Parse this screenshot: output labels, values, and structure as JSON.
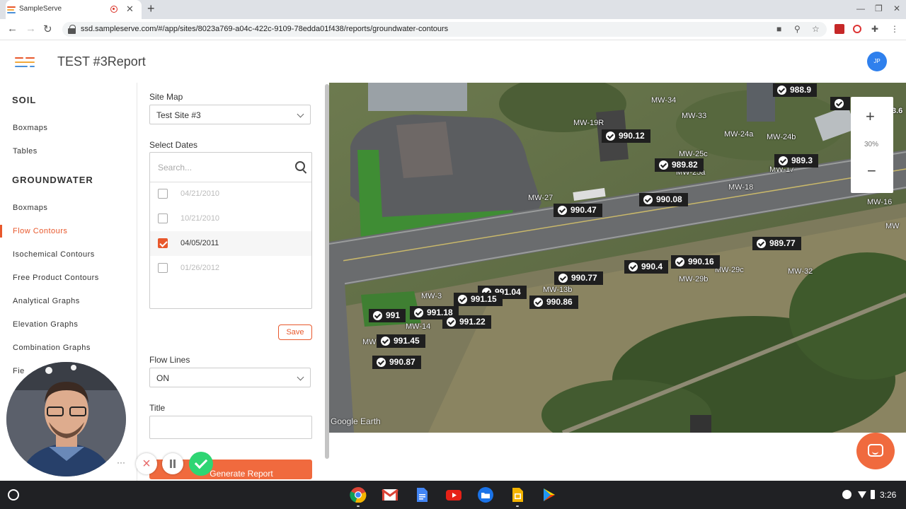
{
  "browser": {
    "tab_title": "SampleServe",
    "url": "ssd.sampleserve.com/#/app/sites/8023a769-a04c-422c-9109-78edda01f438/reports/groundwater-contours"
  },
  "app": {
    "title": "TEST #3Report",
    "user_initials": "JP"
  },
  "sidebar": {
    "soil_heading": "SOIL",
    "soil_items": [
      "Boxmaps",
      "Tables"
    ],
    "groundwater_heading": "GROUNDWATER",
    "groundwater_items": [
      "Boxmaps",
      "Flow Contours",
      "Isochemical Contours",
      "Free Product Contours",
      "Analytical Graphs",
      "Elevation Graphs",
      "Combination Graphs",
      "Fie"
    ],
    "active_item": "Flow Contours"
  },
  "panel": {
    "site_map_label": "Site Map",
    "site_map_value": "Test Site #3",
    "select_dates_label": "Select Dates",
    "search_placeholder": "Search...",
    "dates": [
      {
        "date": "04/21/2010",
        "checked": false
      },
      {
        "date": "10/21/2010",
        "checked": false
      },
      {
        "date": "04/05/2011",
        "checked": true
      },
      {
        "date": "01/26/2012",
        "checked": false
      }
    ],
    "save_label": "Save",
    "flow_lines_label": "Flow Lines",
    "flow_lines_value": "ON",
    "title_label": "Title",
    "title_value": "",
    "generate_label": "Generate Report"
  },
  "map": {
    "zoom_level": "30%",
    "credit": "Google Earth",
    "well_labels": [
      {
        "value": "988.9"
      },
      {
        "value": "990.12"
      },
      {
        "value": "989.82"
      },
      {
        "value": "989.3"
      },
      {
        "value": "990.47"
      },
      {
        "value": "990.08"
      },
      {
        "value": "989.77"
      },
      {
        "value": "990.77"
      },
      {
        "value": "990.4"
      },
      {
        "value": "990.16"
      },
      {
        "value": "991.04"
      },
      {
        "value": "991.15"
      },
      {
        "value": "990.86"
      },
      {
        "value": "991"
      },
      {
        "value": "991.18"
      },
      {
        "value": "991.22"
      },
      {
        "value": "991.45"
      },
      {
        "value": "990.87"
      },
      {
        "value": "3.6"
      }
    ],
    "well_names": [
      "MW-34",
      "MW-33",
      "MW-19R",
      "MW-24a",
      "MW-24b",
      "MW-25c",
      "MW-25a",
      "MW-18",
      "MW-17",
      "MW-27",
      "MW-16",
      "MW",
      "MW-32",
      "MW-29c",
      "MW-29b",
      "MW-13b",
      "MW-3",
      "MW-14",
      "MW"
    ]
  },
  "taskbar": {
    "clock": "3:26",
    "apps": [
      "chrome-icon",
      "gmail-icon",
      "docs-icon",
      "youtube-icon",
      "files-icon",
      "slides-icon",
      "play-store-icon"
    ]
  }
}
